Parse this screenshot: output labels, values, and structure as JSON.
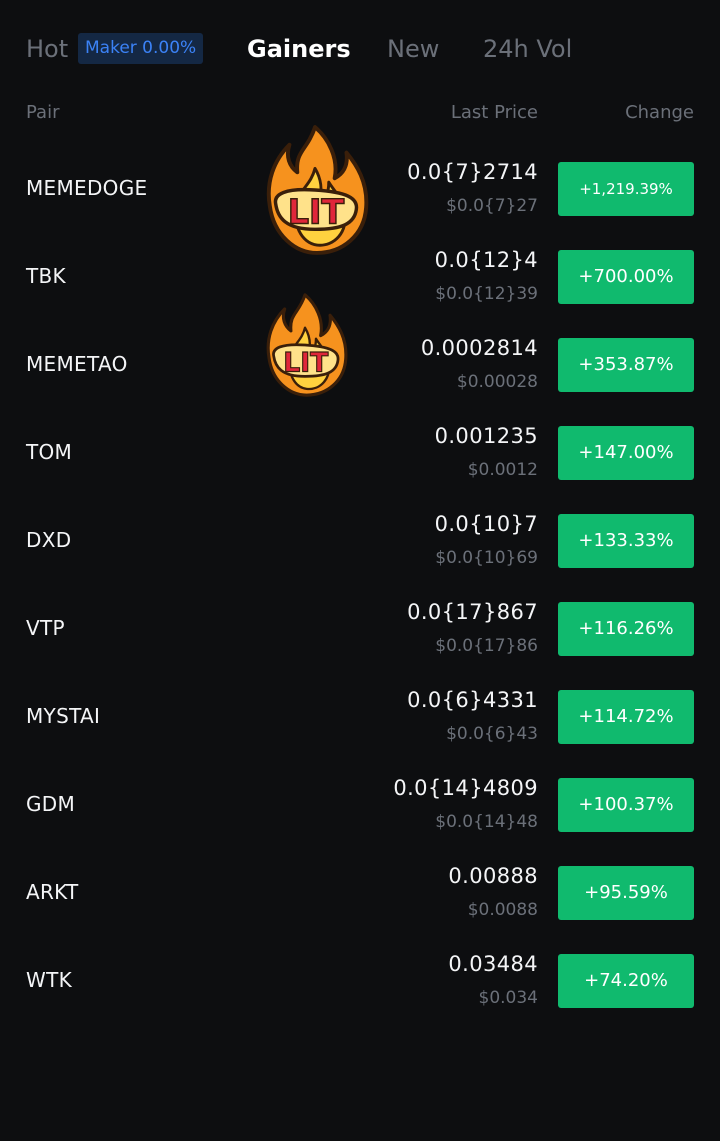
{
  "tabs": {
    "hot": "Hot",
    "maker_badge": "Maker 0.00%",
    "gainers": "Gainers",
    "new": "New",
    "vol": "24h Vol"
  },
  "header": {
    "pair": "Pair",
    "last_price": "Last Price",
    "change": "Change"
  },
  "colors": {
    "background": "#0d0e10",
    "positive": "#10ba6e",
    "muted": "#6b7079",
    "badge_bg": "#142844",
    "badge_text": "#3b82f6"
  },
  "sticker": {
    "icon": "fire-lit-sticker",
    "text": "LIT"
  },
  "rows": [
    {
      "pair": "MEMEDOGE",
      "price": "0.0{7}2714",
      "fiat": "$0.0{7}27",
      "change": "+1,219.39%",
      "sticker": true
    },
    {
      "pair": "TBK",
      "price": "0.0{12}4",
      "fiat": "$0.0{12}39",
      "change": "+700.00%",
      "sticker": false
    },
    {
      "pair": "MEMETAO",
      "price": "0.0002814",
      "fiat": "$0.00028",
      "change": "+353.87%",
      "sticker": true
    },
    {
      "pair": "TOM",
      "price": "0.001235",
      "fiat": "$0.0012",
      "change": "+147.00%",
      "sticker": false
    },
    {
      "pair": "DXD",
      "price": "0.0{10}7",
      "fiat": "$0.0{10}69",
      "change": "+133.33%",
      "sticker": false
    },
    {
      "pair": "VTP",
      "price": "0.0{17}867",
      "fiat": "$0.0{17}86",
      "change": "+116.26%",
      "sticker": false
    },
    {
      "pair": "MYSTAI",
      "price": "0.0{6}4331",
      "fiat": "$0.0{6}43",
      "change": "+114.72%",
      "sticker": false
    },
    {
      "pair": "GDM",
      "price": "0.0{14}4809",
      "fiat": "$0.0{14}48",
      "change": "+100.37%",
      "sticker": false
    },
    {
      "pair": "ARKT",
      "price": "0.00888",
      "fiat": "$0.0088",
      "change": "+95.59%",
      "sticker": false
    },
    {
      "pair": "WTK",
      "price": "0.03484",
      "fiat": "$0.034",
      "change": "+74.20%",
      "sticker": false
    }
  ]
}
